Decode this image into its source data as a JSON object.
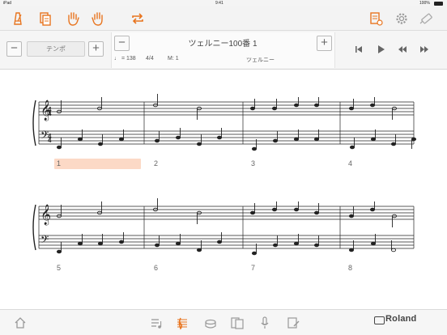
{
  "status": {
    "device": "iPad",
    "time": "9:41",
    "battery": "100%"
  },
  "toolbar": {
    "left_icons": [
      "metronome-icon",
      "song-list-icon",
      "left-hand-icon",
      "right-hand-icon",
      "repeat-icon"
    ],
    "right_icons": [
      "score-settings-icon",
      "gear-icon",
      "bluetooth-tool-icon"
    ]
  },
  "tempo": {
    "label": "テンポ",
    "minus": "−",
    "plus": "+"
  },
  "song": {
    "minus": "−",
    "plus": "+",
    "title": "ツェルニー100番 1",
    "tempo_value": "♩ = 138",
    "time_signature": "4/4",
    "measure": "M: 1",
    "composer": "ツェルニー"
  },
  "transport": [
    "skip-back-icon",
    "play-icon",
    "rewind-icon",
    "fast-forward-icon"
  ],
  "score": {
    "measure_numbers": [
      "1",
      "2",
      "3",
      "4",
      "5",
      "6",
      "7",
      "8"
    ],
    "current_measure": "1",
    "time_sig_top": "4",
    "time_sig_bottom": "4"
  },
  "bottom_nav": [
    "home-icon",
    "playlist-icon",
    "score-icon",
    "drum-icon",
    "cards-icon",
    "microphone-icon",
    "edit-icon"
  ],
  "brand": "Roland",
  "colors": {
    "accent": "#e8741e",
    "highlight": "#fcd9c6"
  }
}
